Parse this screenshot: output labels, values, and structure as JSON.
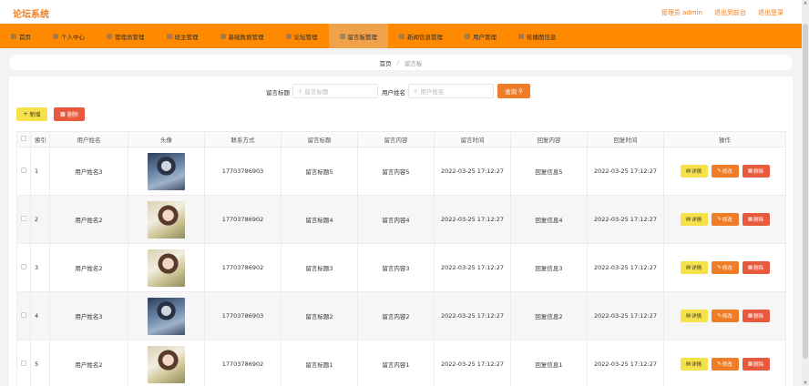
{
  "app": {
    "title": "论坛系统"
  },
  "topbar": {
    "admin_label": "管理员 admin",
    "back_label": "退出到前台",
    "logout_label": "退出登录"
  },
  "nav": {
    "items": [
      {
        "label": "首页",
        "icon": "home-icon"
      },
      {
        "label": "个人中心",
        "icon": "user-icon"
      },
      {
        "label": "管理员管理",
        "icon": "admin-icon"
      },
      {
        "label": "班主管理",
        "icon": "group-icon"
      },
      {
        "label": "基础数据管理",
        "icon": "data-icon"
      },
      {
        "label": "论坛管理",
        "icon": "forum-icon"
      },
      {
        "label": "留言板管理",
        "icon": "message-icon"
      },
      {
        "label": "新闻信息管理",
        "icon": "news-icon"
      },
      {
        "label": "用户管理",
        "icon": "users-icon"
      },
      {
        "label": "轮播图信息",
        "icon": "carousel-icon"
      }
    ],
    "active_index": 6
  },
  "breadcrumb": {
    "home": "首页",
    "separator": "/",
    "current": "留言板"
  },
  "search": {
    "title_label": "留言标题",
    "title_placeholder": "留言标题",
    "username_label": "用户姓名",
    "username_placeholder": "用户姓名",
    "button_label": "查询"
  },
  "actions": {
    "add_label": "新增",
    "delete_label": "删除"
  },
  "table": {
    "columns": [
      "索引",
      "用户姓名",
      "头像",
      "联系方式",
      "留言标题",
      "留言内容",
      "留言时间",
      "回复内容",
      "回复时间",
      "操作"
    ],
    "op_labels": {
      "detail": "详情",
      "edit": "修改",
      "delete": "删除"
    },
    "rows": [
      {
        "index": "1",
        "username": "用户姓名3",
        "avatar": "man",
        "phone": "17703786903",
        "title": "留言标题5",
        "content": "留言内容5",
        "time": "2022-03-25 17:12:27",
        "reply": "回复信息5",
        "reply_time": "2022-03-25 17:12:27"
      },
      {
        "index": "2",
        "username": "用户姓名2",
        "avatar": "woman",
        "phone": "17703786902",
        "title": "留言标题4",
        "content": "留言内容4",
        "time": "2022-03-25 17:12:27",
        "reply": "回复信息4",
        "reply_time": "2022-03-25 17:12:27"
      },
      {
        "index": "3",
        "username": "用户姓名2",
        "avatar": "woman",
        "phone": "17703786902",
        "title": "留言标题3",
        "content": "留言内容3",
        "time": "2022-03-25 17:12:27",
        "reply": "回复信息3",
        "reply_time": "2022-03-25 17:12:27"
      },
      {
        "index": "4",
        "username": "用户姓名3",
        "avatar": "man",
        "phone": "17703786903",
        "title": "留言标题2",
        "content": "留言内容2",
        "time": "2022-03-25 17:12:27",
        "reply": "回复信息2",
        "reply_time": "2022-03-25 17:12:27"
      },
      {
        "index": "5",
        "username": "用户姓名2",
        "avatar": "woman",
        "phone": "17703786902",
        "title": "留言标题1",
        "content": "留言内容1",
        "time": "2022-03-25 17:12:27",
        "reply": "回复信息1",
        "reply_time": "2022-03-25 17:12:27"
      }
    ]
  },
  "colors": {
    "accent": "#ff8a00",
    "brand_text": "#ef7d18",
    "add_button": "#f7e14a",
    "edit_button": "#ef7d28",
    "delete_button": "#e85a3e"
  }
}
